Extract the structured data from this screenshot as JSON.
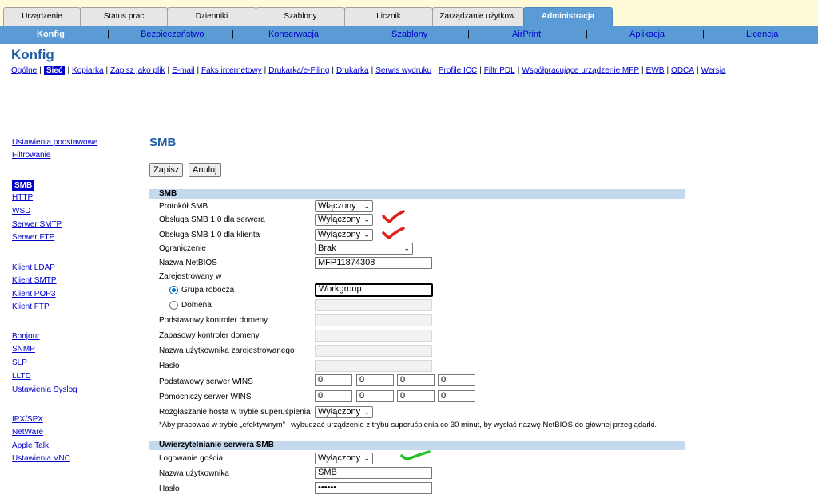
{
  "tabs": [
    {
      "label": "Urządzenie"
    },
    {
      "label": "Status prac"
    },
    {
      "label": "Dzienniki"
    },
    {
      "label": "Szablony"
    },
    {
      "label": "Licznik"
    },
    {
      "label": "Zarządzanie użytkow."
    },
    {
      "label": "Administracja",
      "active": true
    }
  ],
  "subnav": [
    {
      "label": "Konfig",
      "active": true
    },
    {
      "label": "Bezpieczeństwo"
    },
    {
      "label": "Konserwacja"
    },
    {
      "label": "Szablony"
    },
    {
      "label": "AirPrint"
    },
    {
      "label": "Aplikacja"
    },
    {
      "label": "Licencja"
    }
  ],
  "page_title": "Konfig",
  "categories": [
    "Ogólne",
    "Sieć",
    "Kopiarka",
    "Zapisz jako plik",
    "E-mail",
    "Faks internetowy",
    "Drukarka/e-Filing",
    "Drukarka",
    "Serwis wydruku",
    "Profile ICC",
    "Filtr PDL",
    "Współpracujące urządzenie MFP",
    "EWB",
    "ODCA",
    "Wersja"
  ],
  "active_category": "Sieć",
  "sidebar": {
    "group1": [
      "Ustawienia podstawowe",
      "Filtrowanie"
    ],
    "group2": [
      "SMB",
      "HTTP",
      "WSD",
      "Serwer SMTP",
      "Serwer FTP"
    ],
    "group3": [
      "Klient LDAP",
      "Klient SMTP",
      "Klient POP3",
      "Klient FTP"
    ],
    "group4": [
      "Bonjour",
      "SNMP",
      "SLP",
      "LLTD",
      "Ustawienia Syslog"
    ],
    "group5": [
      "IPX/SPX",
      "NetWare",
      "Apple Talk",
      "Ustawienia VNC"
    ],
    "active": "SMB"
  },
  "section_title": "SMB",
  "buttons": {
    "save": "Zapisz",
    "cancel": "Anuluj"
  },
  "smb": {
    "header": "SMB",
    "protocol_label": "Protokół SMB",
    "protocol_value": "Włączony",
    "smb1_server_label": "Obsługa SMB 1.0 dla serwera",
    "smb1_server_value": "Wyłączony",
    "smb1_client_label": "Obsługa SMB 1.0 dla klienta",
    "smb1_client_value": "Wyłączony",
    "restriction_label": "Ograniczenie",
    "restriction_value": "Brak",
    "netbios_label": "Nazwa NetBIOS",
    "netbios_value": "MFP11874308",
    "registered_label": "Zarejestrowany w",
    "workgroup_label": "Grupa robocza",
    "workgroup_value": "Workgroup",
    "domain_label": "Domena",
    "primary_dc_label": "Podstawowy kontroler domeny",
    "backup_dc_label": "Zapasowy kontroler domeny",
    "reg_user_label": "Nazwa użytkownika zarejestrowanego",
    "password_label": "Hasło",
    "primary_wins_label": "Podstawowy serwer WINS",
    "primary_wins": [
      "0",
      "0",
      "0",
      "0"
    ],
    "secondary_wins_label": "Pomocniczy serwer WINS",
    "secondary_wins": [
      "0",
      "0",
      "0",
      "0"
    ],
    "sleep_broadcast_label": "Rozgłaszanie hosta w trybie superuśpienia",
    "sleep_broadcast_value": "Wyłączony",
    "note": "*Aby pracować w trybie „efektywnym” i wybudzać urządzenie z trybu superuśpienia co 30 minut, by wysłać nazwę NetBIOS do głównej przeglądarki."
  },
  "auth": {
    "header": "Uwierzytelnianie serwera SMB",
    "guest_label": "Logowanie gościa",
    "guest_value": "Wyłączony",
    "username_label": "Nazwa użytkownika",
    "username_value": "SMB",
    "password_label": "Hasło",
    "password_value": "••••••"
  },
  "colors": {
    "tab_active": "#5b9bd5",
    "link": "#0000cc",
    "section_header": "#c5d9ee",
    "title": "#1f5fa6",
    "red_mark": "#e0201a",
    "green_mark": "#22c022"
  }
}
